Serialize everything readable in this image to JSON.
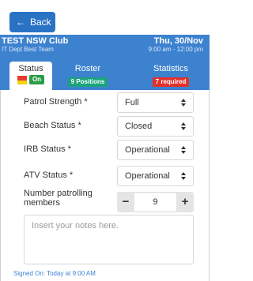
{
  "topbar": {
    "back_label": "Back"
  },
  "header": {
    "club_name": "TEST NSW Club",
    "team_name": "IT Dept Best Team",
    "date": "Thu, 30/Nov",
    "time": "9:00 am - 12:00 pm"
  },
  "tabs": [
    {
      "label": "Status",
      "badge": "On",
      "badge_color": "#2a9d46"
    },
    {
      "label": "Roster",
      "badge": "9 Positions",
      "badge_color": "#1aa37c"
    },
    {
      "label": "Statistics",
      "badge": "7 required",
      "badge_color": "#e2312c"
    }
  ],
  "form": {
    "patrol_strength": {
      "label": "Patrol Strength *",
      "value": "Full"
    },
    "beach_status": {
      "label": "Beach Status *",
      "value": "Closed"
    },
    "irb_status": {
      "label": "IRB Status *",
      "value": "Operational"
    },
    "atv_status": {
      "label": "ATV Status *",
      "value": "Operational"
    },
    "patrolling_members": {
      "label": "Number patrolling members",
      "value": "9",
      "minus": "−",
      "plus": "+"
    },
    "notes": {
      "placeholder": "Insert your notes here."
    }
  },
  "footer": {
    "signed_on": "Signed On: Today at 9:00 AM"
  },
  "colors": {
    "accent": "#3d82cf",
    "button": "#2a73c4"
  }
}
